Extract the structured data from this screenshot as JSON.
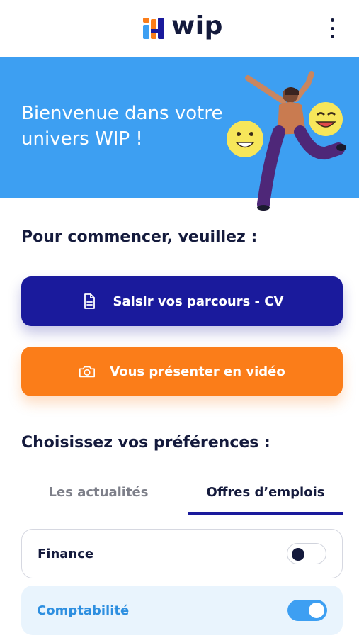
{
  "header": {
    "logo_text": "wip",
    "menu_icon": "kebab-menu-icon"
  },
  "banner": {
    "title": "Bienvenue dans votre univers WIP !",
    "illustration": "celebrating-person-with-smiley-emojis"
  },
  "start_section": {
    "title": "Pour commencer, veuillez  :",
    "cv_button": {
      "label": "Saisir vos parcours - CV",
      "icon": "document-icon"
    },
    "video_button": {
      "label": "Vous présenter en  vidéo",
      "icon": "camera-icon"
    }
  },
  "preferences_section": {
    "title": "Choisissez vos préférences :",
    "tabs": [
      {
        "label": "Les actualités",
        "active": false
      },
      {
        "label": "Offres d’emplois",
        "active": true
      }
    ],
    "items": [
      {
        "label": "Finance",
        "enabled": false
      },
      {
        "label": "Comptabilité",
        "enabled": true
      }
    ]
  },
  "colors": {
    "brand_navy": "#141a3c",
    "primary_blue": "#1a1a9c",
    "banner_blue": "#3d9ff2",
    "orange": "#fb7d19",
    "selected_bg": "#e9f4fd"
  }
}
